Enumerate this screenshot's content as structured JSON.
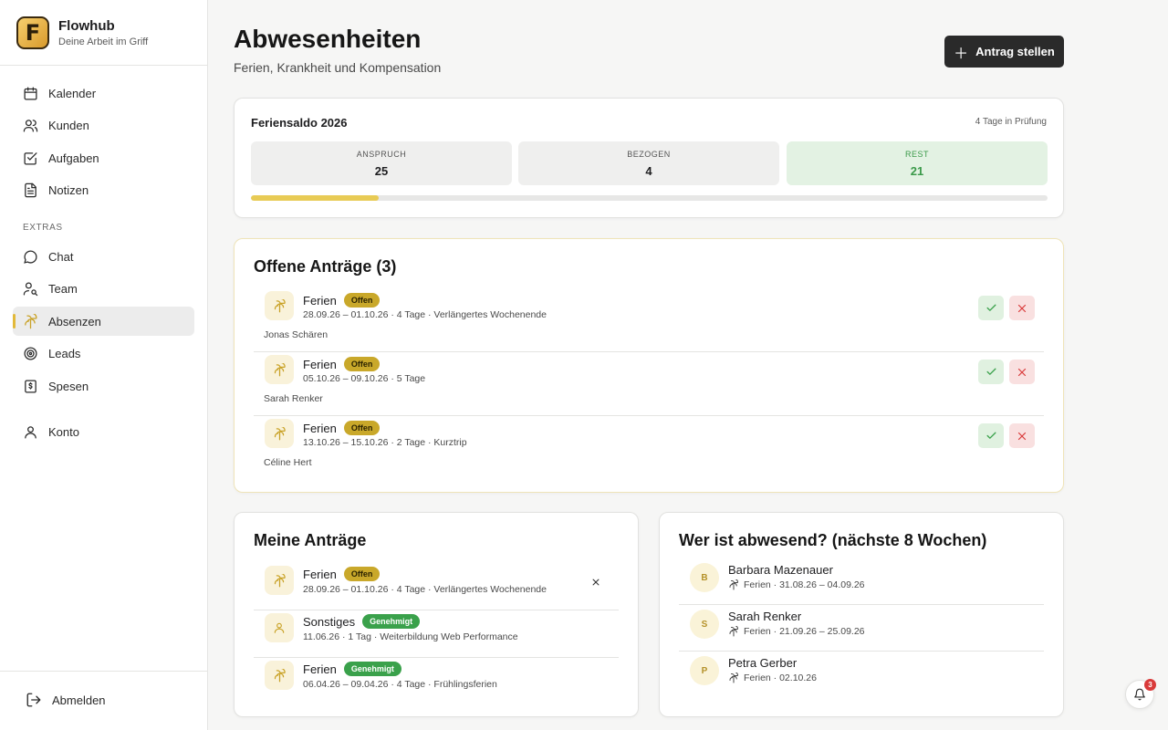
{
  "brand": {
    "name": "Flowhub",
    "tagline": "Deine Arbeit im Griff",
    "logo_letter": "F"
  },
  "nav": {
    "main": [
      {
        "label": "Kalender",
        "icon": "calendar-icon"
      },
      {
        "label": "Kunden",
        "icon": "users-icon"
      },
      {
        "label": "Aufgaben",
        "icon": "checkbox-icon"
      },
      {
        "label": "Notizen",
        "icon": "note-icon"
      }
    ],
    "section_label": "EXTRAS",
    "extras": [
      {
        "label": "Chat",
        "icon": "chat-icon"
      },
      {
        "label": "Team",
        "icon": "team-icon"
      },
      {
        "label": "Absenzen",
        "icon": "palm-tree-icon",
        "active": true
      },
      {
        "label": "Leads",
        "icon": "target-icon"
      },
      {
        "label": "Spesen",
        "icon": "receipt-icon"
      }
    ],
    "account": {
      "label": "Konto",
      "icon": "user-icon"
    },
    "logout": {
      "label": "Abmelden",
      "icon": "logout-icon"
    }
  },
  "header": {
    "title": "Abwesenheiten",
    "subtitle": "Ferien, Krankheit und Kompensation",
    "action_label": "Antrag stellen"
  },
  "balance": {
    "title": "Feriensaldo 2026",
    "note": "4 Tage in Prüfung",
    "stats": [
      {
        "label": "ANSPRUCH",
        "value": "25"
      },
      {
        "label": "BEZOGEN",
        "value": "4"
      },
      {
        "label": "REST",
        "value": "21"
      }
    ],
    "progress_fraction": 0.16
  },
  "open_requests": {
    "title": "Offene Anträge (3)",
    "items": [
      {
        "type": "Ferien",
        "status": "Offen",
        "detail": "28.09.26 – 01.10.26 · 4 Tage · Verlängertes Wochenende",
        "person": "Jonas Schären"
      },
      {
        "type": "Ferien",
        "status": "Offen",
        "detail": "05.10.26 – 09.10.26 · 5 Tage",
        "person": "Sarah Renker"
      },
      {
        "type": "Ferien",
        "status": "Offen",
        "detail": "13.10.26 – 15.10.26 · 2 Tage · Kurztrip",
        "person": "Céline Hert"
      }
    ]
  },
  "my_requests": {
    "title": "Meine Anträge",
    "items": [
      {
        "type": "Ferien",
        "status": "Offen",
        "detail": "28.09.26 – 01.10.26 · 4 Tage · Verlängertes Wochenende",
        "icon": "palm-tree-icon"
      },
      {
        "type": "Sonstiges",
        "status": "Genehmigt",
        "detail": "11.06.26 · 1 Tag · Weiterbildung Web Performance",
        "icon": "user-icon"
      },
      {
        "type": "Ferien",
        "status": "Genehmigt",
        "detail": "06.04.26 – 09.04.26 · 4 Tage · Frühlingsferien",
        "icon": "palm-tree-icon"
      }
    ]
  },
  "absent": {
    "title": "Wer ist abwesend? (nächste 8 Wochen)",
    "items": [
      {
        "initial": "B",
        "name": "Barbara Mazenauer",
        "detail": "Ferien · 31.08.26 – 04.09.26"
      },
      {
        "initial": "S",
        "name": "Sarah Renker",
        "detail": "Ferien · 21.09.26 – 25.09.26"
      },
      {
        "initial": "P",
        "name": "Petra Gerber",
        "detail": "Ferien · 02.10.26"
      }
    ]
  },
  "notifications": {
    "count": "3"
  },
  "colors": {
    "accent": "#e2b93a",
    "open_badge": "#c9a82a",
    "approved_badge": "#3aa14b",
    "rest_green": "#3b9a4a",
    "dark_button": "#2a2a2a"
  }
}
